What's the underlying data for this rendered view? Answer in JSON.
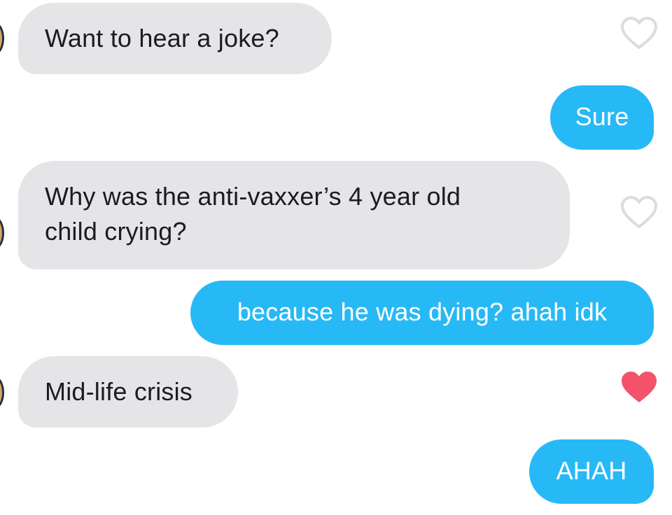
{
  "messages": [
    {
      "from": "match",
      "text": "Want to hear a joke?",
      "liked": false
    },
    {
      "from": "me",
      "text": "Sure"
    },
    {
      "from": "match",
      "text_lines": [
        "Why was the anti-vaxxer’s 4 year old",
        "child crying?"
      ],
      "liked": false
    },
    {
      "from": "me",
      "text": "because he was dying? ahah idk"
    },
    {
      "from": "match",
      "text": "Mid-life crisis",
      "liked": true
    },
    {
      "from": "me",
      "text": "AHAH"
    }
  ],
  "colors": {
    "sent_bubble": "#27b9f5",
    "received_bubble": "#e5e5e8",
    "like_active": "#f2536b",
    "like_inactive": "#dcdce0"
  },
  "icons": {
    "like": "heart-icon",
    "avatar": "match-avatar"
  }
}
